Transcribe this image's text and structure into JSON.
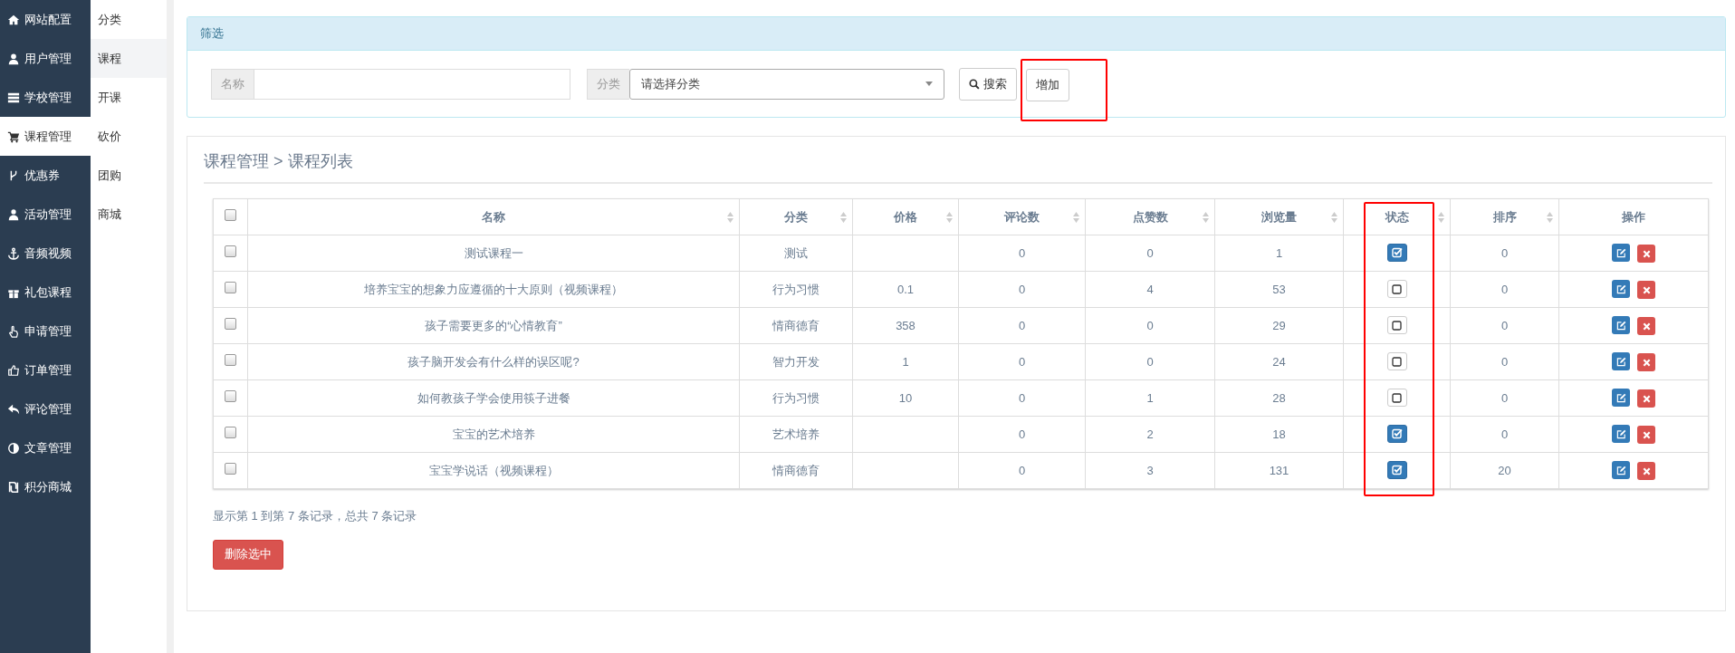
{
  "sidebar": {
    "items": [
      {
        "label": "网站配置",
        "selected": false
      },
      {
        "label": "用户管理",
        "selected": false
      },
      {
        "label": "学校管理",
        "selected": false
      },
      {
        "label": "课程管理",
        "selected": true
      },
      {
        "label": "优惠券",
        "selected": false
      },
      {
        "label": "活动管理",
        "selected": false
      },
      {
        "label": "音频视频",
        "selected": false
      },
      {
        "label": "礼包课程",
        "selected": false
      },
      {
        "label": "申请管理",
        "selected": false
      },
      {
        "label": "订单管理",
        "selected": false
      },
      {
        "label": "评论管理",
        "selected": false
      },
      {
        "label": "文章管理",
        "selected": false
      },
      {
        "label": "积分商城",
        "selected": false
      }
    ]
  },
  "submenu": {
    "items": [
      {
        "label": "分类",
        "selected": false
      },
      {
        "label": "课程",
        "selected": true
      },
      {
        "label": "开课",
        "selected": false
      },
      {
        "label": "砍价",
        "selected": false
      },
      {
        "label": "团购",
        "selected": false
      },
      {
        "label": "商城",
        "selected": false
      }
    ]
  },
  "filter": {
    "title": "筛选",
    "name_label": "名称",
    "category_label": "分类",
    "category_value": "请选择分类",
    "search_button": "搜索",
    "add_button": {
      "label": "增加",
      "highlighted": true
    }
  },
  "list": {
    "breadcrumb": "课程管理 > 课程列表",
    "table": {
      "select_all": {
        "checked": false
      },
      "columns": [
        {
          "label": "名称",
          "sortable": true,
          "highlighted": false
        },
        {
          "label": "分类",
          "sortable": true,
          "highlighted": false
        },
        {
          "label": "价格",
          "sortable": true,
          "highlighted": false
        },
        {
          "label": "评论数",
          "sortable": true,
          "highlighted": false
        },
        {
          "label": "点赞数",
          "sortable": true,
          "highlighted": false
        },
        {
          "label": "浏览量",
          "sortable": true,
          "highlighted": false
        },
        {
          "label": "状态",
          "sortable": true,
          "highlighted": true
        },
        {
          "label": "排序",
          "sortable": true,
          "highlighted": false
        },
        {
          "label": "操作",
          "sortable": false,
          "highlighted": false
        }
      ],
      "rows": [
        {
          "checked": false,
          "name": "测试课程一",
          "category": "测试",
          "comments": "0",
          "likes": "0",
          "views": "1",
          "status": true,
          "sort": "0"
        },
        {
          "checked": false,
          "name": "培养宝宝的想象力应遵循的十大原则（视频课程）",
          "category": "行为习惯",
          "price": "0.1",
          "comments": "0",
          "likes": "4",
          "views": "53",
          "status": false,
          "sort": "0"
        },
        {
          "checked": false,
          "name": "孩子需要更多的“心情教育”",
          "category": "情商德育",
          "price": "358",
          "comments": "0",
          "likes": "0",
          "views": "29",
          "status": false,
          "sort": "0"
        },
        {
          "checked": false,
          "name": "孩子脑开发会有什么样的误区呢?",
          "category": "智力开发",
          "price": "1",
          "comments": "0",
          "likes": "0",
          "views": "24",
          "status": false,
          "sort": "0"
        },
        {
          "checked": false,
          "name": "如何教孩子学会使用筷子进餐",
          "category": "行为习惯",
          "price": "10",
          "comments": "0",
          "likes": "1",
          "views": "28",
          "status": false,
          "sort": "0"
        },
        {
          "checked": false,
          "name": "宝宝的艺术培养",
          "category": "艺术培养",
          "comments": "0",
          "likes": "2",
          "views": "18",
          "status": true,
          "sort": "0"
        },
        {
          "checked": false,
          "name": "宝宝学说话（视频课程）",
          "category": "情商德育",
          "comments": "0",
          "likes": "3",
          "views": "131",
          "status": true,
          "sort": "20"
        }
      ]
    },
    "summary": "显示第 1 到第 7 条记录，总共 7 条记录",
    "delete_button": "删除选中"
  }
}
